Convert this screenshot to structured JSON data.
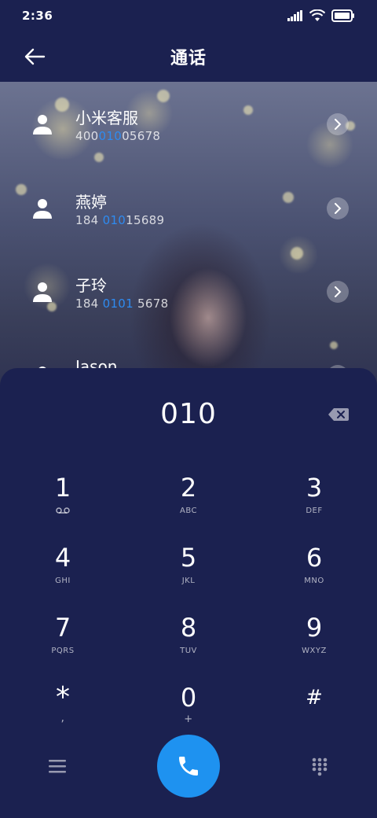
{
  "status_bar": {
    "time": "2:36",
    "icons": [
      "signal-icon",
      "wifi-icon",
      "battery-icon"
    ]
  },
  "header": {
    "title": "通话",
    "back_icon": "back-arrow-icon"
  },
  "contacts": [
    {
      "name": "小米客服",
      "number_parts": [
        "400",
        "010",
        "05678"
      ]
    },
    {
      "name": "燕婷",
      "number_parts": [
        "184 ",
        "010",
        "15689"
      ]
    },
    {
      "name": "子玲",
      "number_parts": [
        "184 ",
        "0101",
        " 5678"
      ]
    },
    {
      "name": "Jason",
      "number_parts": [
        "",
        "",
        ""
      ]
    }
  ],
  "dialer": {
    "input_value": "010",
    "backspace_icon": "backspace-icon",
    "keys": [
      {
        "num": "1",
        "sub": "",
        "sub_icon": "voicemail-icon"
      },
      {
        "num": "2",
        "sub": "ABC"
      },
      {
        "num": "3",
        "sub": "DEF"
      },
      {
        "num": "4",
        "sub": "GHI"
      },
      {
        "num": "5",
        "sub": "JKL"
      },
      {
        "num": "6",
        "sub": "MNO"
      },
      {
        "num": "7",
        "sub": "PQRS"
      },
      {
        "num": "8",
        "sub": "TUV"
      },
      {
        "num": "9",
        "sub": "WXYZ"
      },
      {
        "num": "*",
        "sub": ","
      },
      {
        "num": "0",
        "sub": "+"
      },
      {
        "num": "#",
        "sub": ""
      }
    ]
  },
  "bottom_bar": {
    "menu_icon": "menu-icon",
    "call_icon": "phone-icon",
    "keypad_icon": "dialpad-icon"
  },
  "colors": {
    "background": "#1b2150",
    "accent": "#1e92f0",
    "highlight": "#2e8bf0"
  }
}
